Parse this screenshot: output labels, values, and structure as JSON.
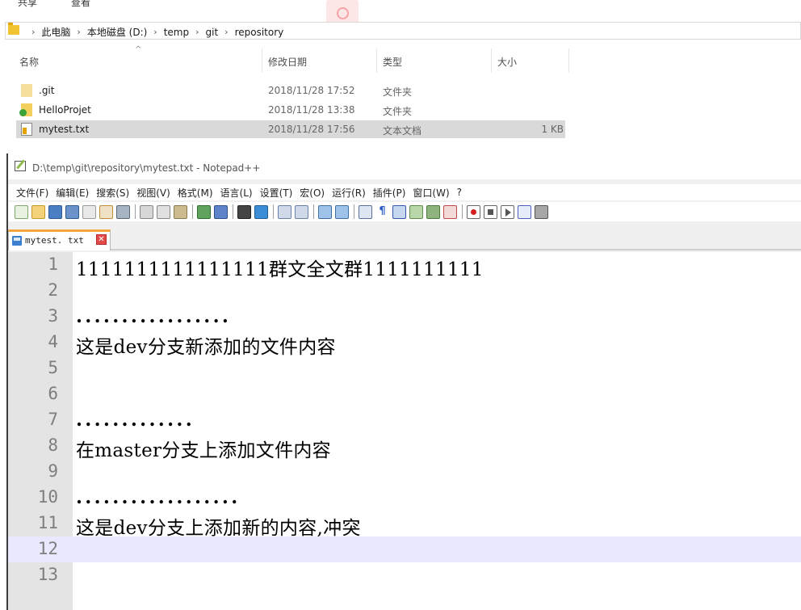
{
  "explorer": {
    "ribbon": [
      "共享",
      "查看"
    ],
    "breadcrumb": [
      "此电脑",
      "本地磁盘 (D:)",
      "temp",
      "git",
      "repository"
    ],
    "columns": {
      "name": "名称",
      "modified": "修改日期",
      "type": "类型",
      "size": "大小"
    },
    "files": [
      {
        "name": ".git",
        "modified": "2018/11/28 17:52",
        "type": "文件夹",
        "size": "",
        "icon": "folder-icon"
      },
      {
        "name": "HelloProjet",
        "modified": "2018/11/28 13:38",
        "type": "文件夹",
        "size": "",
        "icon": "git-folder-icon"
      },
      {
        "name": "mytest.txt",
        "modified": "2018/11/28 17:56",
        "type": "文本文档",
        "size": "1 KB",
        "icon": "text-file-icon"
      }
    ]
  },
  "notepad": {
    "title": "D:\\temp\\git\\repository\\mytest.txt - Notepad++",
    "menu": [
      "文件(F)",
      "编辑(E)",
      "搜索(S)",
      "视图(V)",
      "格式(M)",
      "语言(L)",
      "设置(T)",
      "宏(O)",
      "运行(R)",
      "插件(P)",
      "窗口(W)",
      "?"
    ],
    "tab": {
      "name": "mytest. txt",
      "close": "✕"
    },
    "lines": [
      {
        "n": "1",
        "text": "1111111111111111群文全文群1111111111"
      },
      {
        "n": "2",
        "text": ""
      },
      {
        "n": "3",
        "text": "................."
      },
      {
        "n": "4",
        "text": "这是dev分支新添加的文件内容"
      },
      {
        "n": "5",
        "text": ""
      },
      {
        "n": "6",
        "text": ""
      },
      {
        "n": "7",
        "text": "............."
      },
      {
        "n": "8",
        "text": "在master分支上添加文件内容"
      },
      {
        "n": "9",
        "text": ""
      },
      {
        "n": "10",
        "text": ".................."
      },
      {
        "n": "11",
        "text": "这是dev分支上添加新的内容,冲突"
      },
      {
        "n": "12",
        "text": ""
      },
      {
        "n": "13",
        "text": ""
      }
    ],
    "current_line": "12"
  }
}
